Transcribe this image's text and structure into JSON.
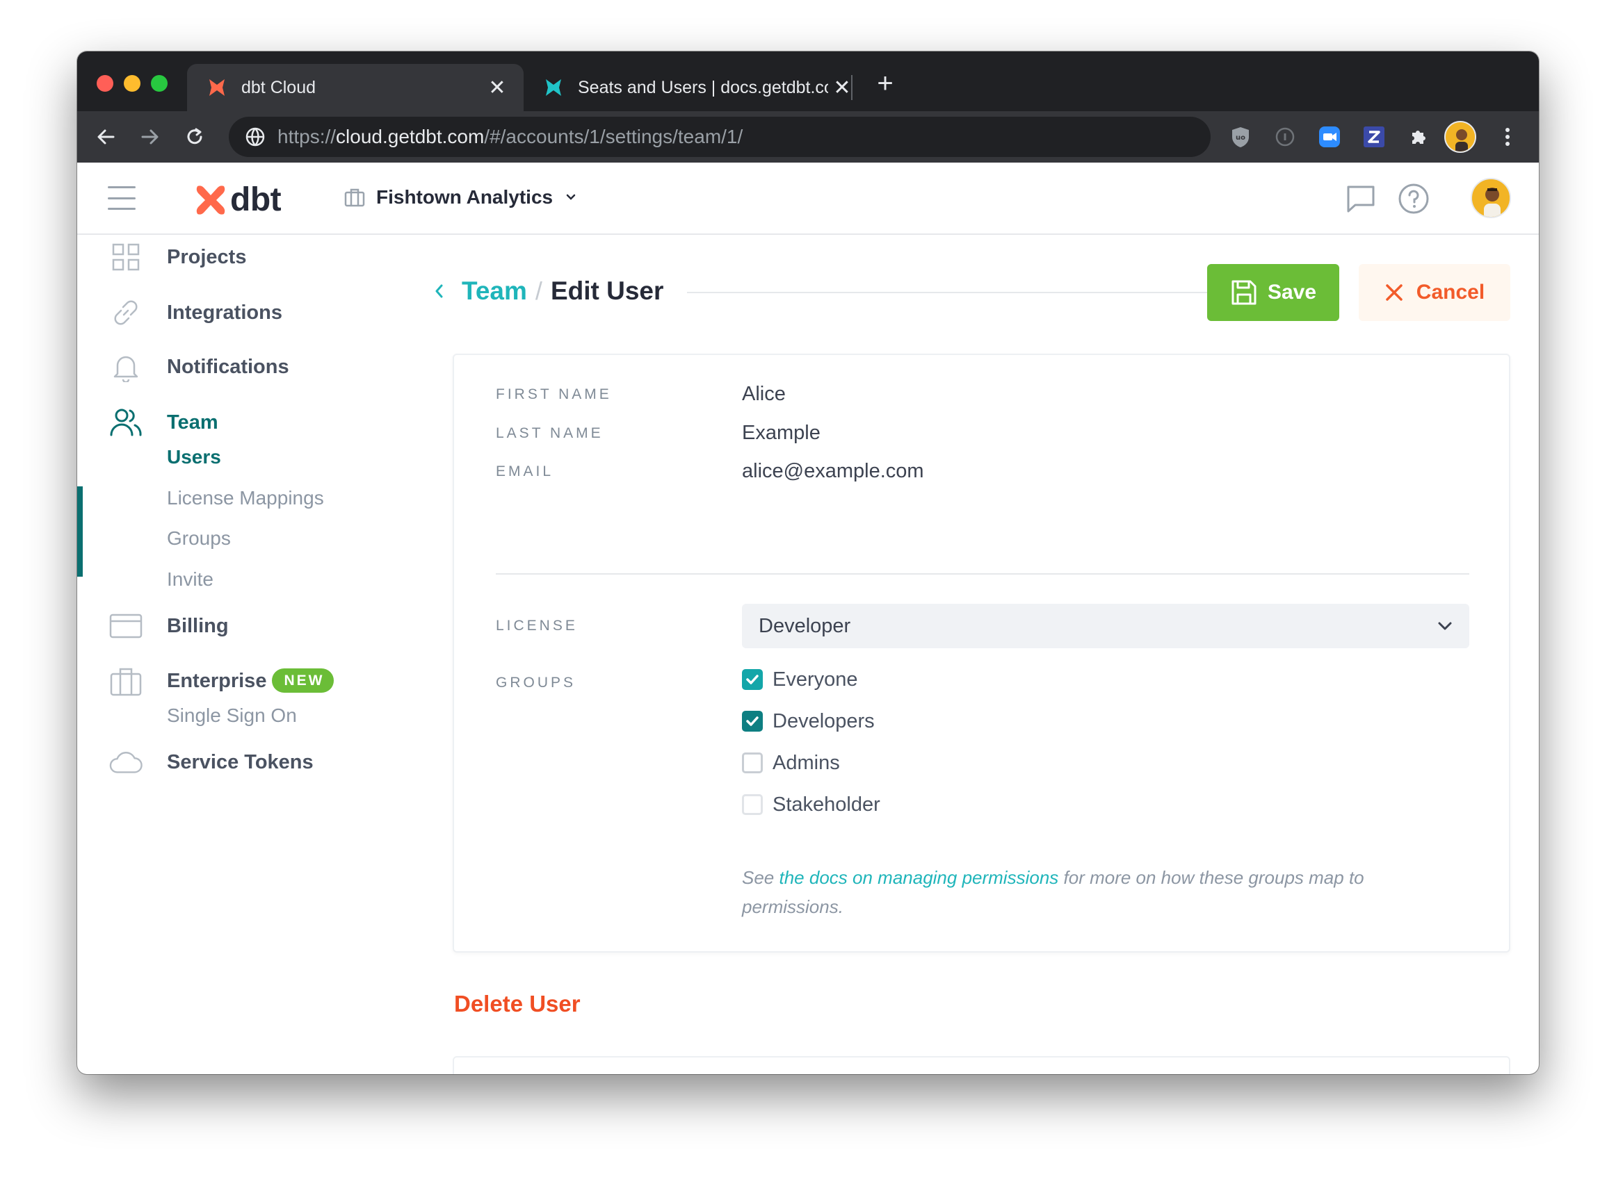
{
  "browser": {
    "tabs": [
      {
        "title": "dbt Cloud",
        "active": true
      },
      {
        "title": "Seats and Users | docs.getdbt.com",
        "active": false
      }
    ],
    "url_prefix": "https://",
    "url_host": "cloud.getdbt.com",
    "url_path": "/#/accounts/1/settings/team/1/"
  },
  "header": {
    "logo_text": "dbt",
    "org_name": "Fishtown Analytics"
  },
  "sidebar": {
    "items": [
      {
        "label": "Projects",
        "icon": "grid-icon"
      },
      {
        "label": "Integrations",
        "icon": "link-icon"
      },
      {
        "label": "Notifications",
        "icon": "bell-icon"
      },
      {
        "label": "Team",
        "icon": "users-icon",
        "active": true
      },
      {
        "label": "Billing",
        "icon": "credit-card-icon"
      },
      {
        "label": "Enterprise",
        "icon": "briefcase-icon",
        "badge": "NEW"
      },
      {
        "label": "Service Tokens",
        "icon": "cloud-icon"
      }
    ],
    "team_sub": [
      "Users",
      "License Mappings",
      "Groups",
      "Invite"
    ],
    "enterprise_sub": [
      "Single Sign On"
    ]
  },
  "breadcrumb": {
    "parent": "Team",
    "separator": "/",
    "current": "Edit User"
  },
  "actions": {
    "save_label": "Save",
    "cancel_label": "Cancel"
  },
  "form": {
    "first_name_label": "FIRST NAME",
    "first_name": "Alice",
    "last_name_label": "LAST NAME",
    "last_name": "Example",
    "email_label": "EMAIL",
    "email": "alice@example.com",
    "license_label": "LICENSE",
    "license_value": "Developer",
    "groups_label": "GROUPS",
    "groups": [
      {
        "name": "Everyone",
        "checked": true
      },
      {
        "name": "Developers",
        "checked": true
      },
      {
        "name": "Admins",
        "checked": false
      },
      {
        "name": "Stakeholder",
        "checked": false
      }
    ],
    "help_prefix": "See ",
    "help_link": "the docs on managing permissions",
    "help_suffix": " for more on how these groups map to permissions."
  },
  "danger": {
    "title": "Delete User"
  },
  "colors": {
    "brand_teal": "#0a6f70",
    "link_teal": "#1fb5ba",
    "save_green": "#6bbd37",
    "cancel_orange": "#f25b2a",
    "danger_red": "#f04e23"
  }
}
